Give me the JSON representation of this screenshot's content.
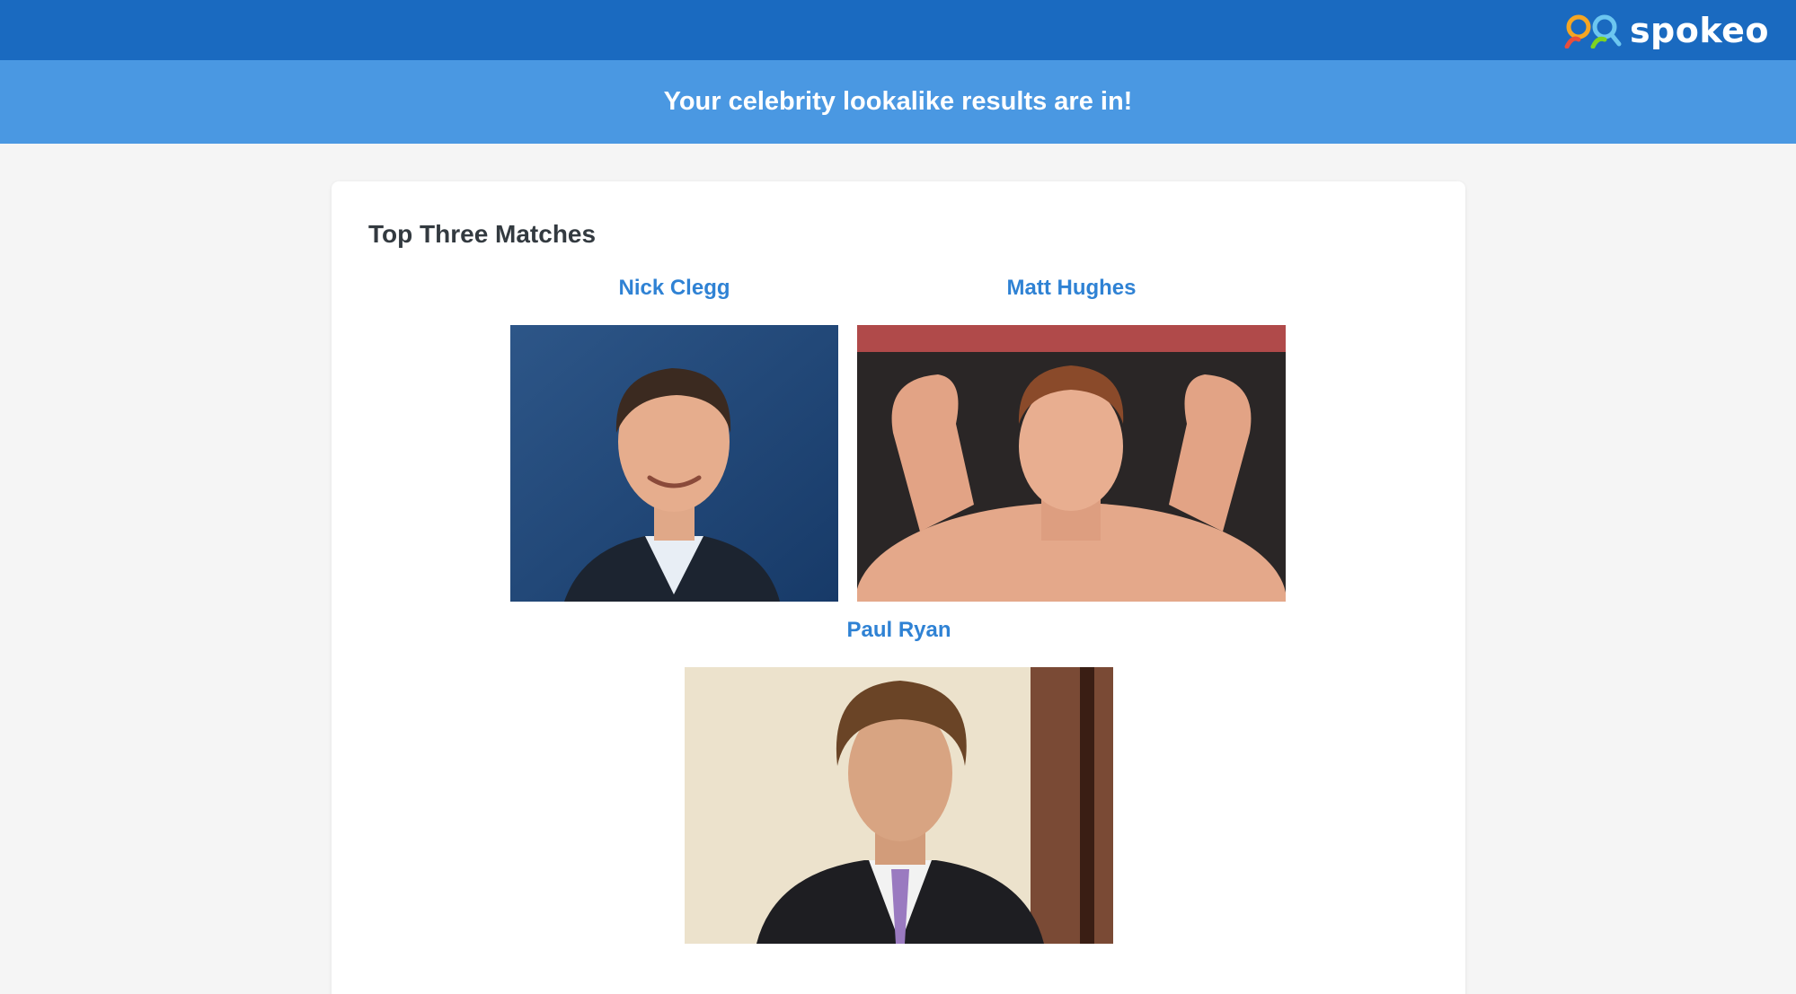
{
  "brand": {
    "name": "spokeo",
    "color": "#1a6ac0"
  },
  "banner": {
    "text": "Your celebrity lookalike results are in!",
    "color": "#4a98e2"
  },
  "results": {
    "title": "Top Three Matches",
    "matches": [
      {
        "name": "Nick Clegg"
      },
      {
        "name": "Matt Hughes"
      },
      {
        "name": "Paul Ryan"
      }
    ]
  }
}
